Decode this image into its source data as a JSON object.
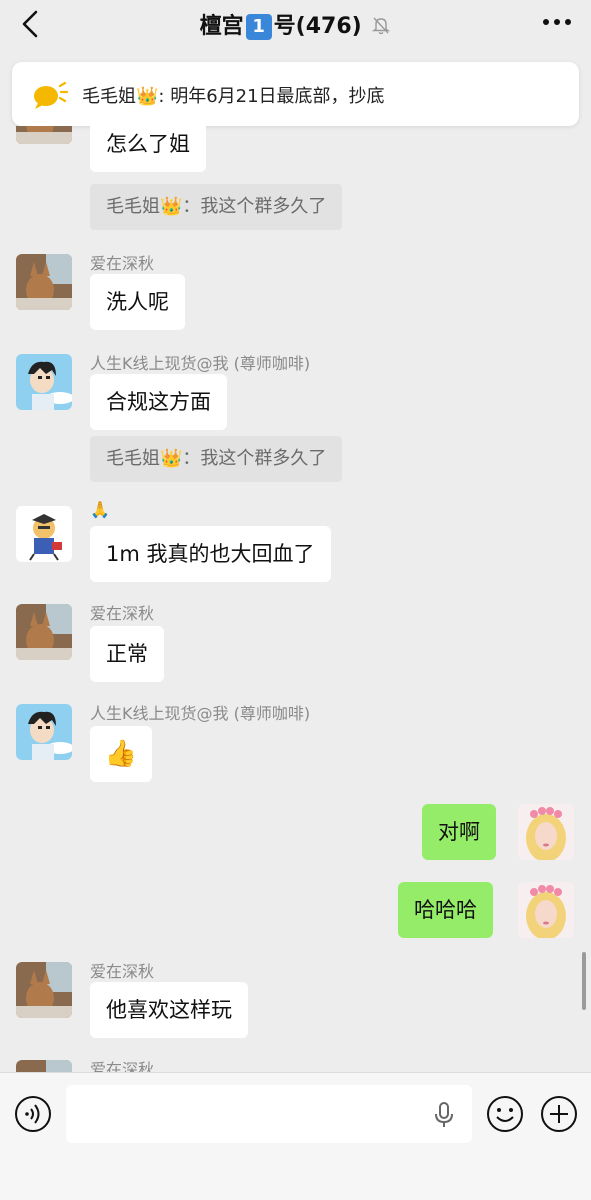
{
  "header": {
    "title_prefix": "檀宫",
    "title_badge": "1",
    "title_suffix": "号",
    "member_count": "(476)"
  },
  "pinned": {
    "text": "毛毛姐👑: 明年6月21日最底部，抄底"
  },
  "messages": [
    {
      "text": "怎么了姐"
    },
    {
      "quote": "毛毛姐👑：我这个群多久了"
    },
    {
      "sender": "爱在深秋",
      "text": "洗人呢"
    },
    {
      "sender": "人生K线上现货@我 (尊师咖啡)",
      "text": "合规这方面"
    },
    {
      "quote": "毛毛姐👑：我这个群多久了"
    },
    {
      "sender": "🙏",
      "text": "1m 我真的也大回血了"
    },
    {
      "sender": "爱在深秋",
      "text": "正常"
    },
    {
      "sender": "人生K线上现货@我 (尊师咖啡)",
      "text": "👍"
    },
    {
      "text": "对啊",
      "own": true
    },
    {
      "text": "哈哈哈",
      "own": true
    },
    {
      "sender": "爱在深秋",
      "text": "他喜欢这样玩"
    },
    {
      "sender": "爱在深秋"
    }
  ],
  "icons": {
    "back": "chevron-left-icon",
    "mute": "bell-off-icon",
    "more": "more-icon",
    "pin": "speech-bubble-icon",
    "voice": "voice-icon",
    "mic": "mic-icon",
    "emoji": "emoji-icon",
    "plus": "plus-icon"
  },
  "colors": {
    "own_bubble": "#95ec69",
    "background": "#ededed",
    "pin_icon": "#f5b800"
  }
}
